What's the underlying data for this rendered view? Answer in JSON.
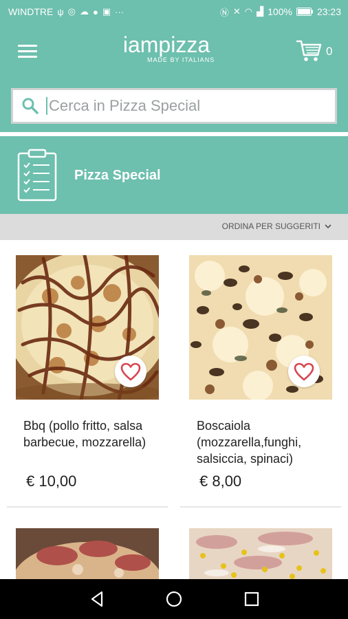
{
  "status_bar": {
    "carrier": "WINDTRE",
    "battery": "100%",
    "time": "23:23"
  },
  "app_bar": {
    "logo_text": "iampizza",
    "logo_tagline": "MADE BY ITALIANS",
    "cart_count": "0"
  },
  "search": {
    "placeholder": "Cerca in Pizza Special"
  },
  "category": {
    "title": "Pizza Special"
  },
  "sort": {
    "label": "ORDINA PER SUGGERITI"
  },
  "products": [
    {
      "name": "Bbq (pollo fritto, salsa barbecue, mozzarella)",
      "price": "€ 10,00"
    },
    {
      "name": "Boscaiola (mozzarella,funghi, salsiccia, spinaci)",
      "price": "€ 8,00"
    }
  ],
  "colors": {
    "primary": "#6dbfae",
    "heart": "#d64550"
  }
}
